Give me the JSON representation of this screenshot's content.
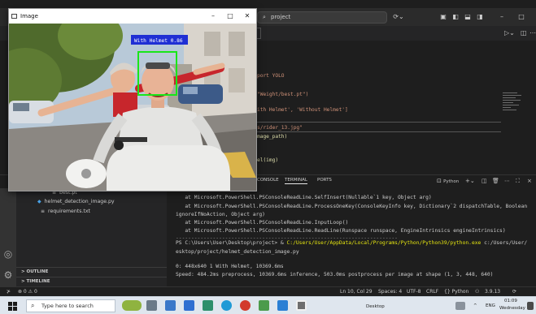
{
  "vscode": {
    "search_text": "project",
    "code_lines": [
      {
        "text": "port YOLO",
        "color": "#ce9178"
      },
      {
        "text": "\"Weight/best.pt\")",
        "color": "#ce9178"
      },
      {
        "text": "ith Helmet', 'Without Helmet']",
        "color": "#ce9178"
      },
      {
        "text": "s/rider_13.jpg\"",
        "color": "#ce9178"
      },
      {
        "text": "mage_path)",
        "color": "#dcdcaa"
      },
      {
        "text": "el(img)",
        "color": "#dcdcaa"
      }
    ],
    "panel_tabs": [
      {
        "label": "CONSOLE",
        "active": false
      },
      {
        "label": "TERMINAL",
        "active": true
      },
      {
        "label": "PORTS",
        "active": false
      }
    ],
    "terminal_profile": "Python",
    "terminal_lines": [
      {
        "text": "   at Microsoft.PowerShell.PSConsoleReadLine.SelfInsert(Nullable`1 key, Object arg)",
        "kind": "normal"
      },
      {
        "text": "   at Microsoft.PowerShell.PSConsoleReadLine.ProcessOneKey(ConsoleKeyInfo key, Dictionary`2 dispatchTable, Boolean",
        "kind": "normal"
      },
      {
        "text": "ignoreIfNoAction, Object arg)",
        "kind": "normal"
      },
      {
        "text": "   at Microsoft.PowerShell.PSConsoleReadLine.InputLoop()",
        "kind": "normal"
      },
      {
        "text": "   at Microsoft.PowerShell.PSConsoleReadLine.ReadLine(Runspace runspace, EngineIntrinsics engineIntrinsics)",
        "kind": "normal"
      },
      {
        "text": "------------------------------------------------------------------------",
        "kind": "sep"
      },
      {
        "prompt": "PS C:\\Users\\User\\Desktop\\project> & ",
        "highlight": "C:/Users/User/AppData/Local/Programs/Python/Python39/python.exe",
        "rest": " c:/Users/User/",
        "kind": "cmd"
      },
      {
        "text": "esktop/project/helmet_detection_image.py",
        "kind": "normal"
      },
      {
        "text": "",
        "kind": "blank"
      },
      {
        "text": "0: 448x640 1 With Helmet, 10369.6ms",
        "kind": "normal"
      },
      {
        "text": "Speed: 484.2ms preprocess, 10369.6ms inference, 503.0ms postprocess per image at shape (1, 3, 448, 640)",
        "kind": "normal"
      }
    ],
    "sidebar": {
      "files": [
        {
          "name": "best.pt",
          "icon": "≡"
        },
        {
          "name": "helmet_detection_image.py",
          "icon": "◆"
        },
        {
          "name": "requirements.txt",
          "icon": "≡"
        }
      ],
      "sections": [
        "OUTLINE",
        "TIMELINE"
      ]
    },
    "status": {
      "left": "⊗ 0 ⚠ 0",
      "position": "Ln 10, Col 29",
      "spaces": "Spaces: 4",
      "encoding": "UTF-8",
      "eol": "CRLF",
      "language": "{} Python",
      "version": "3.9.13"
    }
  },
  "image_window": {
    "title": "Image",
    "detection_label": "With Helmet 0.86",
    "box_color": "#19e619",
    "label_bg": "#1f2fd4"
  },
  "taskbar": {
    "search_placeholder": "Type here to search",
    "desktop_label": "Desktop",
    "lang": "ENG",
    "time": "01:09",
    "day": "Wednesday"
  }
}
